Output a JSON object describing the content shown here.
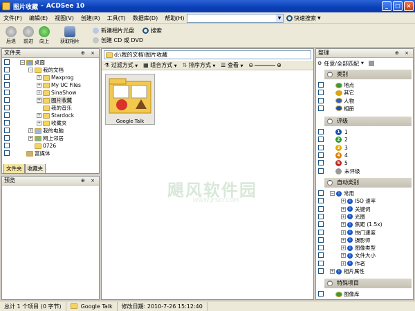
{
  "title": {
    "app": "图片收藏",
    "sep": "-",
    "product": "ACDSee 10"
  },
  "window_controls": {
    "minimize": "_",
    "maximize": "□",
    "close": "×"
  },
  "menu": [
    "文件(F)",
    "编辑(E)",
    "视图(V)",
    "创建(R)",
    "工具(T)",
    "数据库(D)",
    "帮助(H)"
  ],
  "quick_search": {
    "label": "快速搜索"
  },
  "toolbar": {
    "back": "后退",
    "forward": "前进",
    "up": "向上",
    "acquire": "获取相片",
    "new_album_disc": "新建相片光盘",
    "create_cd": "创建 CD 或 DVD",
    "search": "搜索"
  },
  "folders": {
    "header": "文件夹",
    "tree": [
      {
        "label": "桌面",
        "exp": "−",
        "icon": "desktop"
      },
      {
        "label": "我的文档",
        "exp": "−",
        "icon": "folder"
      },
      {
        "label": "Maxprog",
        "exp": "+",
        "icon": "folder"
      },
      {
        "label": "My UC Files",
        "exp": "+",
        "icon": "folder"
      },
      {
        "label": "SinaShow",
        "exp": "+",
        "icon": "folder"
      },
      {
        "label": "图片收藏",
        "exp": "+",
        "icon": "folder"
      },
      {
        "label": "我的音乐",
        "exp": "",
        "icon": "folder"
      },
      {
        "label": "Stardock",
        "exp": "+",
        "icon": "folder"
      },
      {
        "label": "收藏夹",
        "exp": "+",
        "icon": "star"
      },
      {
        "label": "我的电脑",
        "exp": "+",
        "icon": "computer"
      },
      {
        "label": "网上邻居",
        "exp": "+",
        "icon": "network"
      },
      {
        "label": "0726",
        "exp": "",
        "icon": "folder"
      },
      {
        "label": "富媒体",
        "exp": "",
        "icon": "media"
      }
    ],
    "tabs": [
      "文件夹",
      "收藏夹"
    ]
  },
  "preview": {
    "header": "预览"
  },
  "browser": {
    "path": "d:\\我的文档\\图片收藏",
    "filter": "过滤方式",
    "group": "组合方式",
    "sort": "排序方式",
    "view": "查看",
    "items": [
      {
        "name": "Google Talk"
      }
    ]
  },
  "organize": {
    "header": "整理",
    "match": "任意/全部匹配",
    "sections": [
      {
        "title": "类别",
        "items": [
          "地点",
          "其它",
          "人物",
          "相册"
        ]
      },
      {
        "title": "评级",
        "items": [
          "1",
          "2",
          "3",
          "4",
          "5",
          "未评级"
        ]
      },
      {
        "title": "自动类别",
        "items": [
          "常用",
          "ISO 速率",
          "关键词",
          "光圈",
          "焦距 (1.5x)",
          "快门速度",
          "摄影师",
          "图像类型",
          "文件大小",
          "作者",
          "相片属性"
        ]
      },
      {
        "title": "特殊项目",
        "items": [
          "图像库"
        ]
      }
    ]
  },
  "status": {
    "total": "总计 1 个项目 (0 字节)",
    "current": "Google Talk",
    "modified": "修改日期: 2010-7-26 15:12:40"
  },
  "watermark": {
    "cn": "飓风软件园",
    "url": "WWW.JFSKY.COM"
  },
  "colors": {
    "title_bar": "#0a3fb8",
    "pane_bg": "#ffffff",
    "selected": "#e8e6df"
  }
}
